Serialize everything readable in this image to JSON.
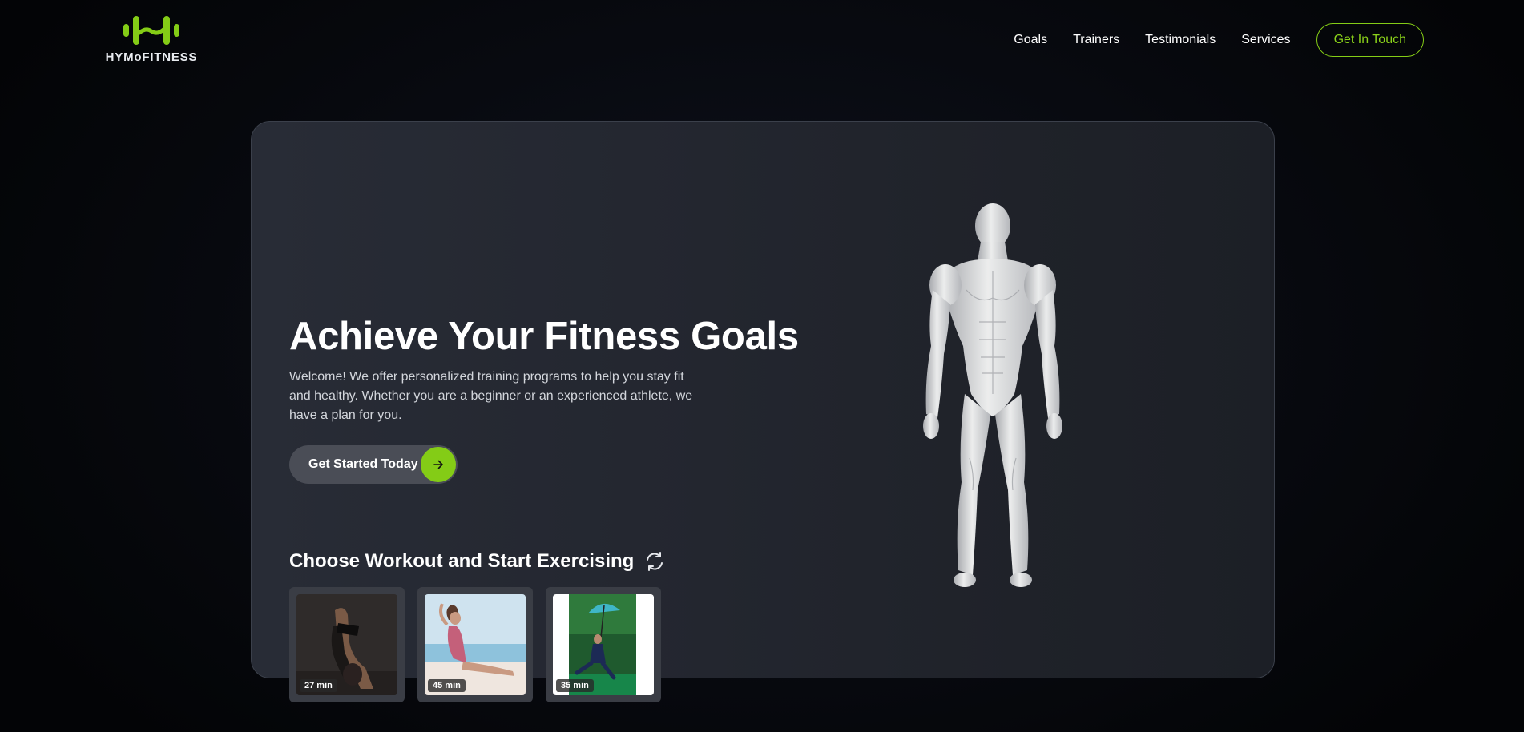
{
  "brand": {
    "name": "HYMoFITNESS",
    "accent": "#84cc16"
  },
  "nav": {
    "links": [
      "Goals",
      "Trainers",
      "Testimonials",
      "Services"
    ],
    "cta": "Get In Touch"
  },
  "hero": {
    "title": "Achieve Your Fitness Goals",
    "description": "Welcome! We offer personalized training programs to help you stay fit and healthy. Whether you are a beginner or an experienced athlete, we have a plan for you.",
    "cta_label": "Get Started Today",
    "cta_icon": "arrow-right-icon",
    "figure": "muscular-body-figure"
  },
  "workouts": {
    "title": "Choose Workout and Start Exercising",
    "refresh_icon": "refresh-icon",
    "items": [
      {
        "duration": "27 min",
        "image": "yoga-forward-fold-photo"
      },
      {
        "duration": "45 min",
        "image": "beach-stretch-photo"
      },
      {
        "duration": "35 min",
        "image": "umbrella-dance-photo"
      }
    ]
  }
}
